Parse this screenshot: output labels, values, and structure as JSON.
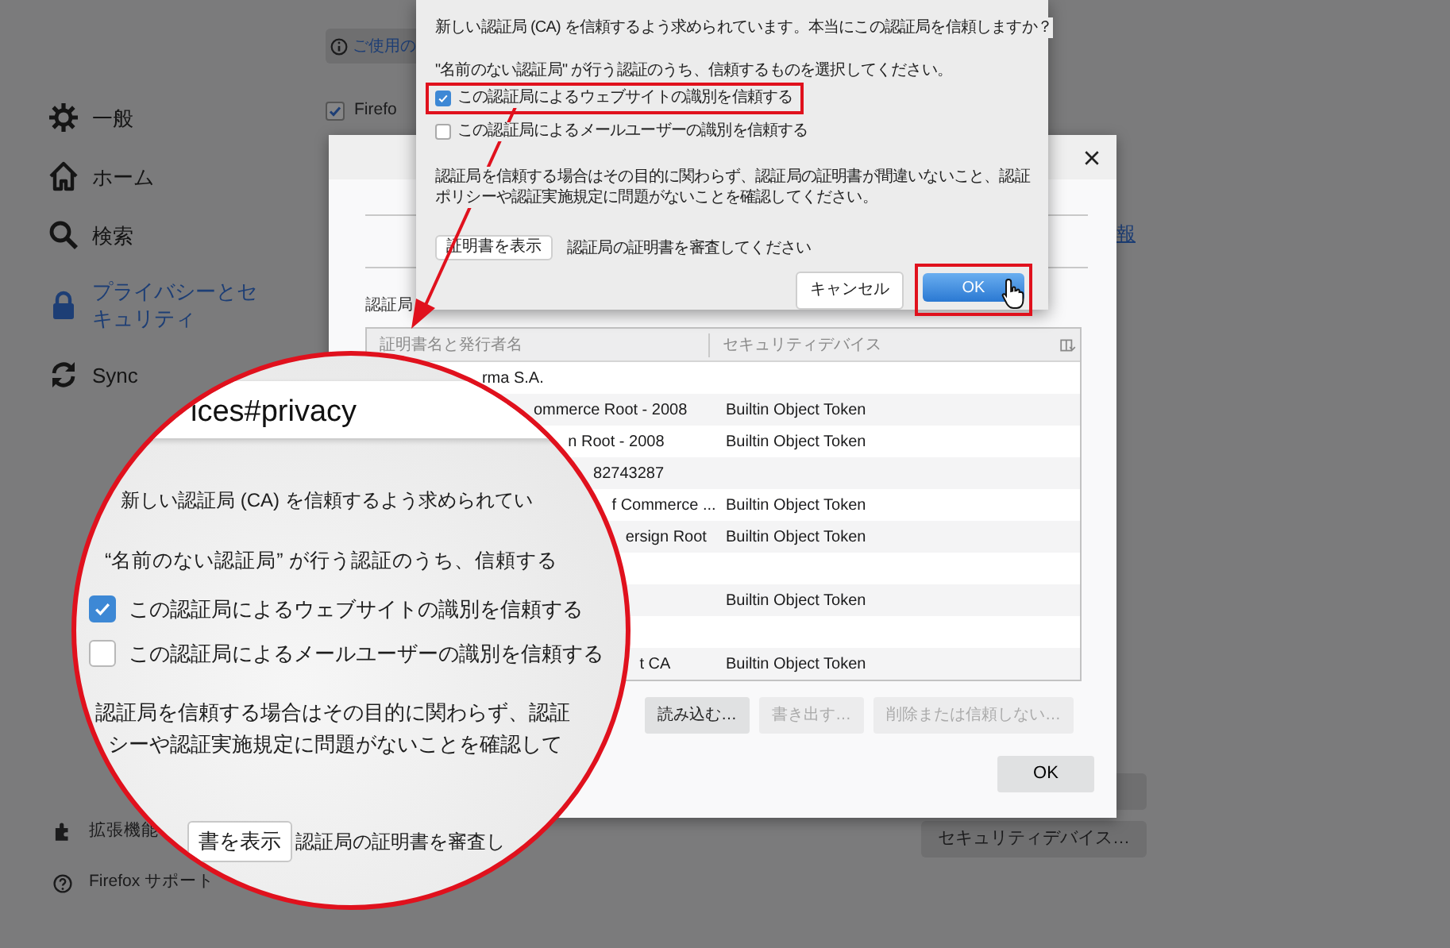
{
  "sidebar": {
    "items": [
      {
        "label": "一般",
        "selected": false
      },
      {
        "label": "ホーム",
        "selected": false
      },
      {
        "label": "検索",
        "selected": false
      },
      {
        "label": "プライバシーとセキュリティ",
        "selected": true
      },
      {
        "label": "Sync",
        "selected": false
      }
    ],
    "footer": [
      {
        "label": "拡張機能"
      },
      {
        "label": "Firefox サポート"
      }
    ]
  },
  "page": {
    "info_bar": "ご使用の",
    "checkbox": {
      "label": "Firefo",
      "checked": true
    },
    "link": "報",
    "security_button": "セキュリティデバイス…"
  },
  "certificate_manager": {
    "section_label": "認証局",
    "columns": [
      "証明書名と発行者名",
      "セキュリティデバイス"
    ],
    "rows": [
      {
        "name": "rma S.A."
      },
      {
        "name": "ommerce Root - 2008",
        "device": "Builtin Object Token"
      },
      {
        "name": "n Root - 2008",
        "device": "Builtin Object Token"
      },
      {
        "name": "82743287"
      },
      {
        "name": "f Commerce ...",
        "device": "Builtin Object Token"
      },
      {
        "name": "ersign Root",
        "device": "Builtin Object Token"
      },
      {},
      {
        "device": "Builtin Object Token"
      },
      {},
      {
        "name": "t CA",
        "device": "Builtin Object Token"
      }
    ],
    "buttons": [
      {
        "label": "読み込む…",
        "disabled": false
      },
      {
        "label": "書き出す…",
        "disabled": true
      },
      {
        "label": "削除または信頼しない…",
        "disabled": true
      }
    ],
    "ok_button": "OK"
  },
  "trust_dialog": {
    "message": "新しい認証局 (CA) を信頼するよう求められています。本当にこの認証局を信頼しますか？",
    "prompt": "\"名前のない認証局\" が行う認証のうち、信頼するものを選択してください。",
    "options": [
      {
        "label": "この認証局によるウェブサイトの識別を信頼する",
        "checked": true,
        "highlighted": true
      },
      {
        "label": "この認証局によるメールユーザーの識別を信頼する",
        "checked": false,
        "highlighted": false
      }
    ],
    "note": "認証局を信頼する場合はその目的に関わらず、認証局の証明書が間違いないこと、認証ポリシーや認証実施規定に問題がないことを確認してください。",
    "view_button": "証明書を表示",
    "view_hint": "認証局の証明書を審査してください",
    "cancel_button": "キャンセル",
    "ok_button": {
      "label": "OK",
      "highlighted": true
    }
  },
  "magnifier": {
    "url": "ices#privacy",
    "message": "新しい認証局 (CA) を信頼するよう求められてい",
    "prompt": "“名前のない認証局” が行う認証のうち、信頼する",
    "options": [
      {
        "label": "この認証局によるウェブサイトの識別を信頼する",
        "checked": true
      },
      {
        "label": "この認証局によるメールユーザーの識別を信頼する",
        "checked": false
      }
    ],
    "note_lines": [
      "認証局を信頼する場合はその目的に関わらず、認証",
      "シーや認証実施規定に問題がないことを確認して"
    ],
    "view_button": "書を表示",
    "view_hint": "認証局の証明書を審査し"
  }
}
